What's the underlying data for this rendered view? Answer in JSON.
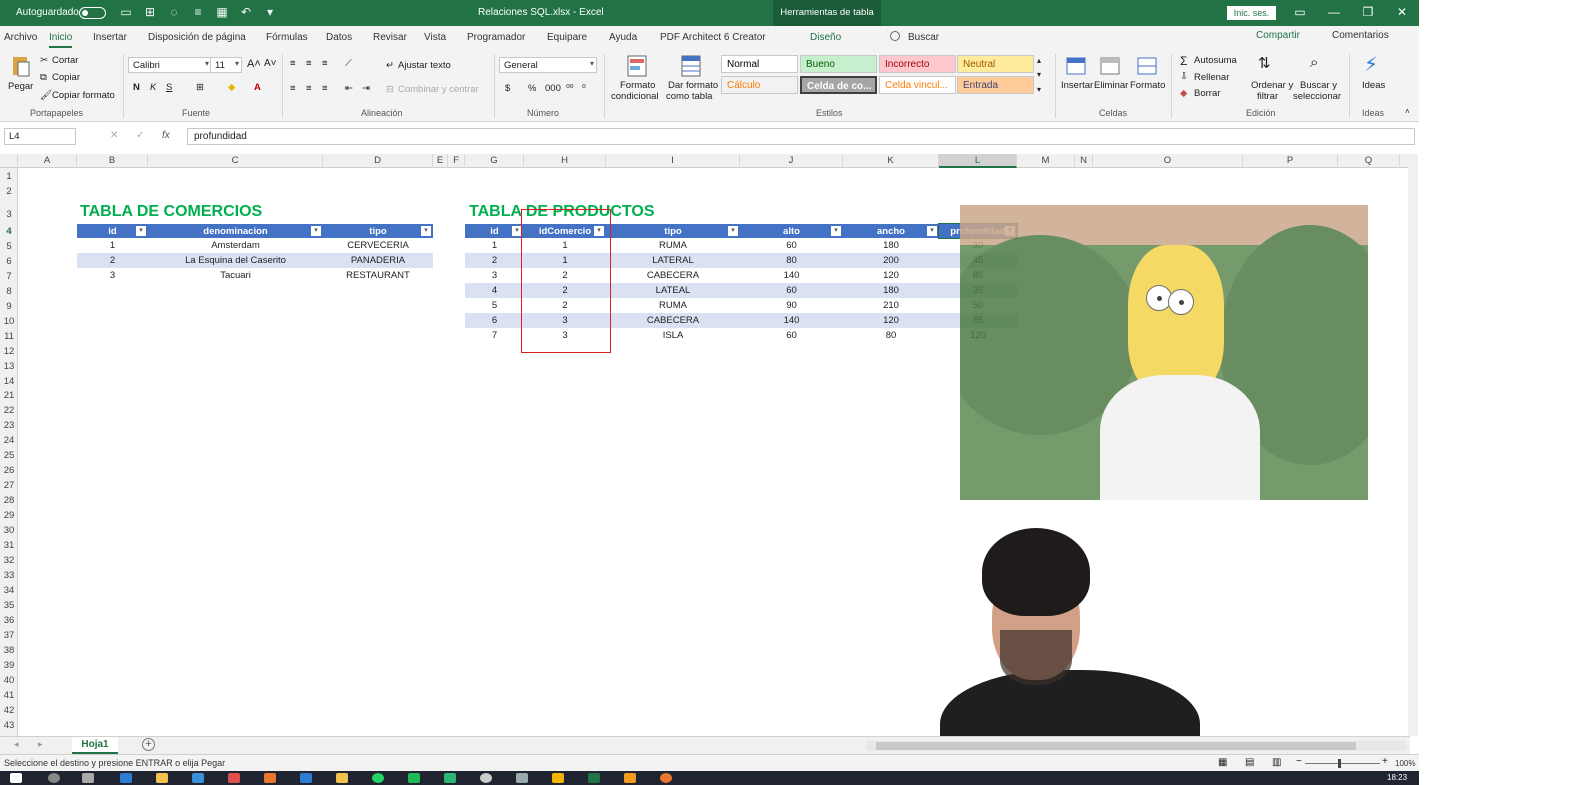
{
  "titlebar": {
    "autosave": "Autoguardado",
    "title": "Relaciones SQL.xlsx  -  Excel",
    "tools": "Herramientas de tabla",
    "signin": "Inic. ses."
  },
  "tabs": [
    "Archivo",
    "Inicio",
    "Insertar",
    "Disposición de página",
    "Fórmulas",
    "Datos",
    "Revisar",
    "Vista",
    "Programador",
    "Equipare",
    "Ayuda",
    "PDF Architect 6 Creator",
    "Diseño"
  ],
  "search_label": "Buscar",
  "share_label": "Compartir",
  "comments_label": "Comentarios",
  "ribbon": {
    "paste": "Pegar",
    "cut": "Cortar",
    "copy": "Copiar",
    "format_painter": "Copiar formato",
    "clipboard_group": "Portapapeles",
    "font_name": "Calibri",
    "font_size": "11",
    "font_group": "Fuente",
    "wrap_text": "Ajustar texto",
    "merge_center": "Combinar y centrar",
    "alignment_group": "Alineación",
    "number_format": "General",
    "number_group": "Número",
    "cond_format_1": "Formato",
    "cond_format_2": "condicional",
    "table_format_1": "Dar formato",
    "table_format_2": "como tabla",
    "styles": {
      "normal": "Normal",
      "bueno": "Bueno",
      "incorrecto": "Incorrecto",
      "neutral": "Neutral",
      "calculo": "Cálculo",
      "celda_co": "Celda de co...",
      "celda_vinc": "Celda vincul...",
      "entrada": "Entrada"
    },
    "styles_group": "Estilos",
    "insert": "Insertar",
    "delete": "Eliminar",
    "format": "Formato",
    "cells_group": "Celdas",
    "autosum": "Autosuma",
    "fill": "Rellenar",
    "clear": "Borrar",
    "sort_1": "Ordenar y",
    "sort_2": "filtrar",
    "find_1": "Buscar y",
    "find_2": "seleccionar",
    "editing_group": "Edición",
    "ideas": "Ideas",
    "ideas_group": "Ideas"
  },
  "formula_bar": {
    "name_box": "L4",
    "fx": "fx",
    "content": "profundidad"
  },
  "columns": [
    "A",
    "B",
    "C",
    "D",
    "E",
    "F",
    "G",
    "H",
    "I",
    "J",
    "K",
    "L",
    "M",
    "N",
    "O",
    "P",
    "Q"
  ],
  "rows": [
    "1",
    "2",
    "3",
    "4",
    "5",
    "6",
    "7",
    "8",
    "9",
    "10",
    "11",
    "12",
    "13",
    "14",
    "21",
    "22",
    "23",
    "24",
    "25",
    "26",
    "27",
    "28",
    "29",
    "30",
    "31",
    "32",
    "33",
    "34",
    "35",
    "36",
    "37",
    "38",
    "39",
    "40",
    "41",
    "42",
    "43"
  ],
  "comercios": {
    "title": "TABLA DE COMERCIOS",
    "headers": [
      "id",
      "denominacion",
      "tipo"
    ],
    "rows": [
      [
        "1",
        "Amsterdam",
        "CERVECERIA"
      ],
      [
        "2",
        "La Esquina del Caserito",
        "PANADERIA"
      ],
      [
        "3",
        "Tacuari",
        "RESTAURANT"
      ]
    ]
  },
  "productos": {
    "title": "TABLA DE PRODUCTOS",
    "headers": [
      "id",
      "idComercio",
      "tipo",
      "alto",
      "ancho",
      "profundidad"
    ],
    "rows": [
      [
        "1",
        "1",
        "RUMA",
        "60",
        "180",
        "30"
      ],
      [
        "2",
        "1",
        "LATERAL",
        "80",
        "200",
        "45"
      ],
      [
        "3",
        "2",
        "CABECERA",
        "140",
        "120",
        "85"
      ],
      [
        "4",
        "2",
        "LATEAL",
        "60",
        "180",
        "35"
      ],
      [
        "5",
        "2",
        "RUMA",
        "90",
        "210",
        "50"
      ],
      [
        "6",
        "3",
        "CABECERA",
        "140",
        "120",
        "85"
      ],
      [
        "7",
        "3",
        "ISLA",
        "60",
        "80",
        "120"
      ]
    ]
  },
  "sheet_tab": "Hoja1",
  "status": "Seleccione el destino y presione ENTRAR o elija Pegar",
  "zoom": "100%",
  "clock": "18:23"
}
